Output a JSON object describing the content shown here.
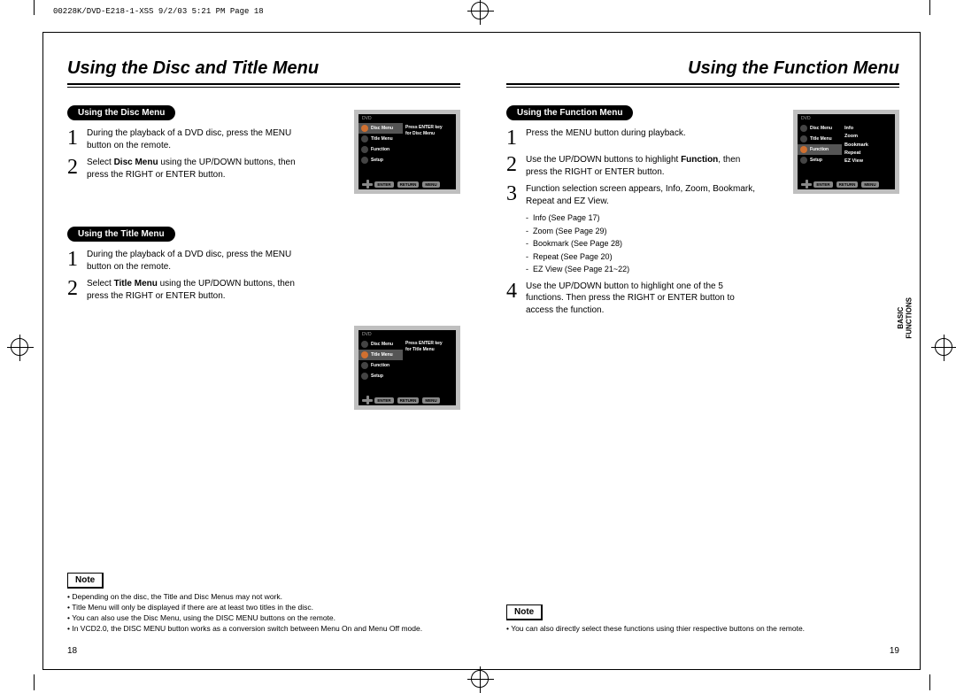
{
  "print_header": "00228K/DVD-E218-1-XSS  9/2/03 5:21 PM  Page 18",
  "left": {
    "title": "Using the Disc and Title Menu",
    "disc": {
      "pill": "Using the Disc Menu",
      "s1": "During the playback of a DVD disc, press the MENU button on the remote.",
      "s2_pre": "Select ",
      "s2_bold": "Disc Menu",
      "s2_post": " using the UP/DOWN buttons, then press the RIGHT or ENTER button."
    },
    "titlem": {
      "pill": "Using the Title Menu",
      "s1": "During the playback of a DVD disc, press the MENU button on the remote.",
      "s2_pre": "Select ",
      "s2_bold": "Title Menu",
      "s2_post": " using the UP/DOWN buttons, then press the RIGHT or ENTER button."
    },
    "note_label": "Note",
    "notes": [
      "Depending on the disc, the Title and Disc Menus may not work.",
      "Title Menu will only be displayed if there are at least two titles in the disc.",
      "You can also use the Disc Menu, using the DISC MENU buttons on the remote.",
      "In VCD2.0, the DISC MENU button works as a conversion switch between Menu On and Menu Off mode."
    ],
    "page_num": "18"
  },
  "right": {
    "title": "Using the Function Menu",
    "pill": "Using the Function Menu",
    "s1": "Press the MENU button during playback.",
    "s2_pre": "Use the UP/DOWN buttons to highlight ",
    "s2_bold": "Function",
    "s2_post": ", then press the RIGHT or ENTER button.",
    "s3": "Function selection screen appears, Info, Zoom, Bookmark, Repeat and EZ View.",
    "subs": [
      "Info (See Page 17)",
      "Zoom (See Page 29)",
      "Bookmark (See Page 28)",
      "Repeat (See Page 20)",
      "EZ View (See Page 21~22)"
    ],
    "s4": "Use the UP/DOWN button to highlight one of the 5 functions. Then press the RIGHT or ENTER button to access the function.",
    "note_label": "Note",
    "notes": [
      "You can also directly select these functions using thier respective buttons on the remote."
    ],
    "page_num": "19",
    "side_tab_l1": "BASIC",
    "side_tab_l2": "FUNCTIONS"
  },
  "screen": {
    "hdr": "DVD",
    "menu_items": [
      "Disc Menu",
      "Title Menu",
      "Function",
      "Setup"
    ],
    "promptA_l1": "Press ENTER key",
    "promptA_l2": "for Disc Menu",
    "promptB_l1": "Press ENTER key",
    "promptB_l2": "for Title Menu",
    "func": [
      "Info",
      "Zoom",
      "Bookmark",
      "Repeat",
      "EZ View"
    ],
    "btns": [
      "ENTER",
      "RETURN",
      "MENU"
    ]
  }
}
